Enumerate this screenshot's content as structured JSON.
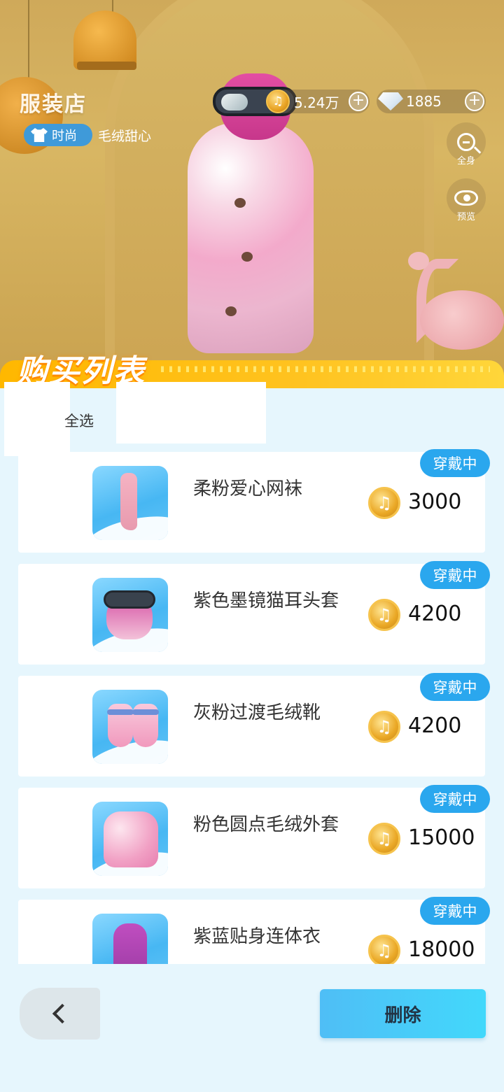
{
  "header": {
    "title": "服装店",
    "tag": "时尚",
    "outfit_name": "毛绒甜心"
  },
  "currency": {
    "coins": "5.24万",
    "diamonds": "1885"
  },
  "side_controls": {
    "zoom_label": "全身",
    "preview_label": "预览"
  },
  "list": {
    "title": "购买列表",
    "select_all_label": "全选",
    "items": [
      {
        "name": "柔粉爱心网袜",
        "price": "3000",
        "status": "穿戴中",
        "icon": "stocking-icon"
      },
      {
        "name": "紫色墨镜猫耳头套",
        "price": "4200",
        "status": "穿戴中",
        "icon": "cat-ear-hood-icon"
      },
      {
        "name": "灰粉过渡毛绒靴",
        "price": "4200",
        "status": "穿戴中",
        "icon": "fluffy-boots-icon"
      },
      {
        "name": "粉色圆点毛绒外套",
        "price": "15000",
        "status": "穿戴中",
        "icon": "fluffy-coat-icon"
      },
      {
        "name": "紫蓝贴身连体衣",
        "price": "18000",
        "status": "穿戴中",
        "icon": "bodysuit-icon"
      }
    ]
  },
  "footer": {
    "delete_label": "删除"
  },
  "colors": {
    "accent_blue": "#2aa7ee",
    "banner_yellow": "#ffc320",
    "page_bg": "#e6f6fd"
  }
}
